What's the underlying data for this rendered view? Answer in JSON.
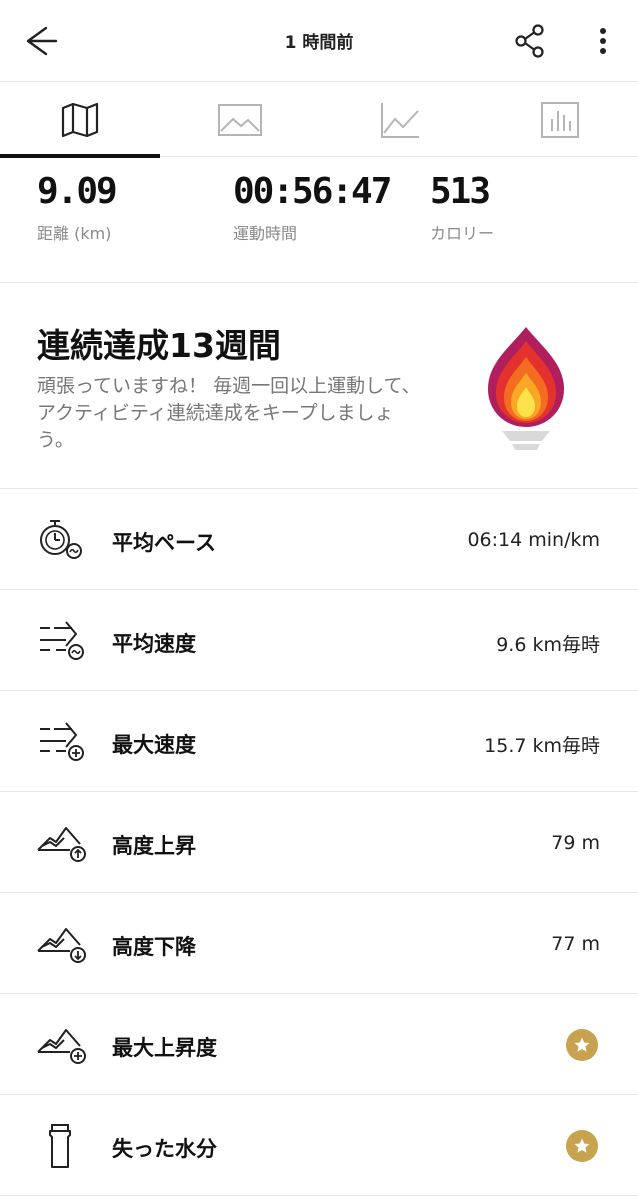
{
  "header": {
    "title": "1 時間前",
    "back_icon": "back-arrow-icon",
    "share_icon": "share-icon",
    "more_icon": "more-vertical-icon"
  },
  "tabs": [
    {
      "icon": "map-icon",
      "active": true
    },
    {
      "icon": "image-icon",
      "active": false
    },
    {
      "icon": "line-chart-icon",
      "active": false
    },
    {
      "icon": "bar-chart-icon",
      "active": false
    }
  ],
  "summary": {
    "distance": {
      "value": "9.09",
      "label": "距離 (km)"
    },
    "duration": {
      "value": "00:56:47",
      "label": "運動時間"
    },
    "calories": {
      "value": "513",
      "label": "カロリー"
    }
  },
  "streak": {
    "title": "連続達成13週間",
    "description": "頑張っていますね！ 毎週一回以上運動して、アクティビティ連続達成をキープしましょう。",
    "icon": "torch-flame-icon"
  },
  "metrics": [
    {
      "label": "平均ペース",
      "value": "06:14 min/km",
      "icon": "stopwatch-icon"
    },
    {
      "label": "平均速度",
      "value": "9.6 km毎時",
      "icon": "speed-average-icon"
    },
    {
      "label": "最大速度",
      "value": "15.7 km毎時",
      "icon": "speed-max-icon"
    },
    {
      "label": "高度上昇",
      "value": "79 m",
      "icon": "elevation-gain-icon"
    },
    {
      "label": "高度下降",
      "value": "77 m",
      "icon": "elevation-loss-icon"
    },
    {
      "label": "最大上昇度",
      "value": "",
      "icon": "elevation-max-icon",
      "premium": true
    },
    {
      "label": "失った水分",
      "value": "",
      "icon": "water-bottle-icon",
      "premium": true
    }
  ],
  "colors": {
    "premium_star": "#c7a24f",
    "divider": "#e6e6e6"
  }
}
